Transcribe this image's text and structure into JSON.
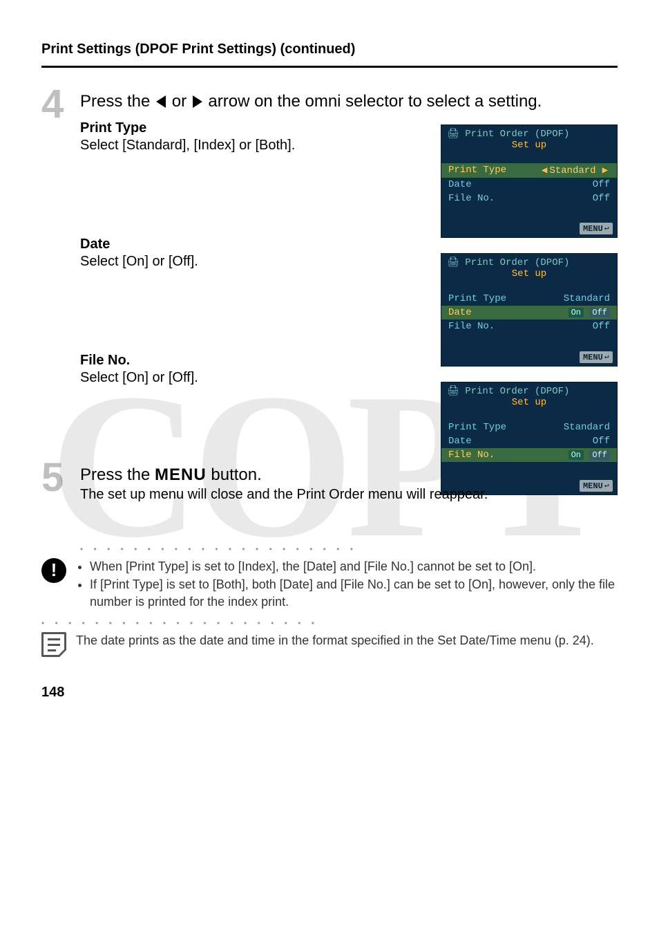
{
  "header": "Print Settings (DPOF Print Settings) (continued)",
  "step4": {
    "num": "4",
    "title_pre": "Press the ",
    "title_mid": " or ",
    "title_post": " arrow on the omni selector to select a setting.",
    "groups": [
      {
        "label": "Print Type",
        "text": "Select [Standard], [Index] or [Both]."
      },
      {
        "label": "Date",
        "text": "Select [On] or [Off]."
      },
      {
        "label": "File No.",
        "text": "Select [On] or [Off]."
      }
    ]
  },
  "shots": {
    "title": "Print Order (DPOF)",
    "subtitle": "Set up",
    "menu": "MENU",
    "s1": {
      "rows": [
        {
          "lbl": "Print Type",
          "val": "Standard",
          "sel": true,
          "arrows": true
        },
        {
          "lbl": "Date",
          "val": "Off"
        },
        {
          "lbl": "File No.",
          "val": "Off"
        }
      ]
    },
    "s2": {
      "rows": [
        {
          "lbl": "Print Type",
          "val": "Standard"
        },
        {
          "lbl": "Date",
          "val_on": "On",
          "val_off": "Off",
          "sel": true
        },
        {
          "lbl": "File No.",
          "val": "Off"
        }
      ]
    },
    "s3": {
      "rows": [
        {
          "lbl": "Print Type",
          "val": "Standard"
        },
        {
          "lbl": "Date",
          "val": "Off"
        },
        {
          "lbl": "File No.",
          "val_on": "On",
          "val_off": "Off",
          "sel": true
        }
      ]
    }
  },
  "step5": {
    "num": "5",
    "title": "Press the ",
    "menu": "MENU",
    "title2": " button.",
    "text": "The set up menu will close and the Print Order menu will reappear."
  },
  "note1_b1": "When [Print Type] is set to [Index], the [Date] and [File No.] cannot be set to [On].",
  "note1_b2": "If [Print Type] is set to [Both], both [Date] and [File No.] can be set to [On], however, only the file number is printed for the index print.",
  "note2": "The date prints as the date and time in the format specified in the Set Date/Time menu (p. 24).",
  "page": "148",
  "watermark": "COPY"
}
